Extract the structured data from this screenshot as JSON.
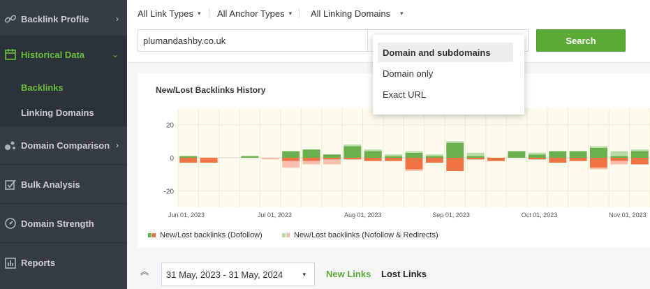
{
  "sidebar": {
    "items": [
      {
        "label": "Backlink Profile",
        "icon": "link-icon"
      },
      {
        "label": "Historical Data",
        "icon": "calendar-icon"
      },
      {
        "label": "Domain Comparison",
        "icon": "comparison-icon"
      },
      {
        "label": "Bulk Analysis",
        "icon": "checklist-icon"
      },
      {
        "label": "Domain Strength",
        "icon": "gauge-icon"
      },
      {
        "label": "Reports",
        "icon": "report-icon"
      }
    ],
    "sub_items": [
      {
        "label": "Backlinks"
      },
      {
        "label": "Linking Domains"
      }
    ]
  },
  "filters": {
    "link_types": "All Link Types",
    "anchor_types": "All Anchor Types",
    "linking_domains": "All Linking Domains"
  },
  "search": {
    "domain_value": "plumandashby.co.uk",
    "button_label": "Search"
  },
  "scope_dropdown": {
    "options": [
      "Domain and subdomains",
      "Domain only",
      "Exact URL"
    ],
    "selected": "Domain and subdomains"
  },
  "colors": {
    "accent_green": "#5aaa35",
    "dofollow_new": "#6ab04c",
    "dofollow_lost": "#f07245",
    "nofollow_new": "#b8dca8",
    "nofollow_lost": "#f8bfae",
    "chart_bg": "#fdfbeb"
  },
  "chart_data": {
    "type": "bar",
    "title": "New/Lost Backlinks History",
    "ylim": [
      -30,
      30
    ],
    "yticks": [
      20,
      0,
      -20
    ],
    "xtick_labels": [
      "Jun 01, 2023",
      "Jul 01, 2023",
      "Aug 01, 2023",
      "Sep 01, 2023",
      "Oct 01, 2023",
      "Nov 01, 2023"
    ],
    "weeks": 23,
    "series": [
      {
        "name": "New/Lost backlinks (Dofollow)",
        "new": [
          1,
          0,
          0,
          1,
          0,
          4,
          5,
          2,
          7,
          4,
          1,
          3,
          1,
          9,
          1,
          0,
          4,
          2,
          4,
          4,
          6,
          1,
          4
        ],
        "lost": [
          -3,
          -3,
          0,
          0,
          0,
          -2,
          -2,
          -1,
          -1,
          -2,
          -2,
          -7,
          -3,
          -8,
          -1,
          -2,
          0,
          -1,
          -3,
          -2,
          -6,
          -2,
          -4
        ]
      },
      {
        "name": "New/Lost backlinks (Nofollow & Redirects)",
        "new": [
          0,
          0,
          0,
          0,
          0,
          0,
          0,
          0,
          1,
          1,
          1,
          1,
          1,
          1,
          2,
          0,
          0,
          1,
          0,
          0,
          1,
          3,
          1
        ],
        "lost": [
          0,
          0,
          0,
          0,
          -1,
          -4,
          -2,
          -3,
          0,
          0,
          0,
          -1,
          0,
          0,
          0,
          0,
          0,
          0,
          0,
          0,
          -1,
          -2,
          0
        ]
      }
    ],
    "grid": true,
    "legend_position": "bottom-left"
  },
  "bottom": {
    "date_range": "31 May, 2023 - 31 May, 2024",
    "tab_new": "New Links",
    "tab_lost": "Lost Links"
  }
}
